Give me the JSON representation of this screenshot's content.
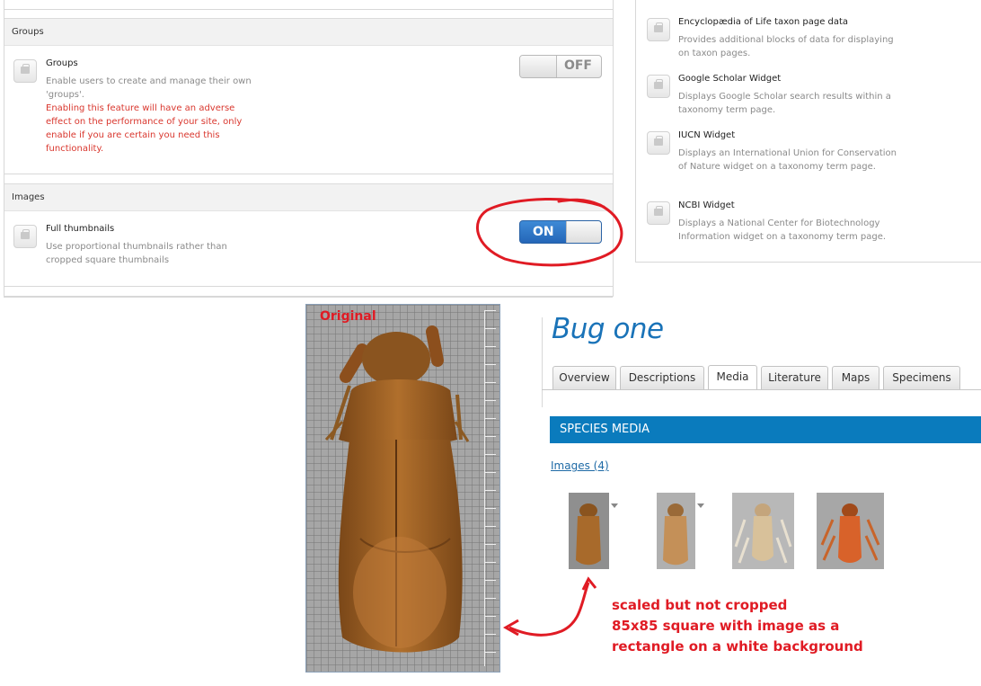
{
  "settings": {
    "groups_section": {
      "header": "Groups",
      "feature_title": "Groups",
      "description": "Enable users to create and manage their own 'groups'.",
      "warning": "Enabling this feature will have an adverse effect on the performance of your site, only enable if you are certain you need this functionality.",
      "toggle_label": "OFF",
      "toggle_state": "off"
    },
    "images_section": {
      "header": "Images",
      "feature_title": "Full thumbnails",
      "description": "Use proportional thumbnails rather than cropped square thumbnails",
      "toggle_label": "ON",
      "toggle_state": "on"
    }
  },
  "modules": [
    {
      "title": "Encyclopædia of Life taxon page data",
      "description": "Provides additional blocks of data for displaying on taxon pages."
    },
    {
      "title": "Google Scholar Widget",
      "description": "Displays Google Scholar search results within a taxonomy term page."
    },
    {
      "title": "IUCN Widget",
      "description": "Displays an International Union for Conservation of Nature widget on a taxonomy term page."
    },
    {
      "title": "NCBI Widget",
      "description": "Displays a National Center for Biotechnology Information widget on a taxonomy term page."
    }
  ],
  "taxon_page": {
    "title": "Bug one",
    "tabs": [
      "Overview",
      "Descriptions",
      "Media",
      "Literature",
      "Maps",
      "Specimens"
    ],
    "active_tab": "Media",
    "section_header": "SPECIES MEDIA",
    "images_link": "Images (4)"
  },
  "annotations": {
    "original_label": "Original",
    "note_line1": "scaled but not cropped",
    "note_line2": "85x85 square with image as a",
    "note_line3": "rectangle on a white background"
  },
  "colors": {
    "accent_blue": "#0a7bbd",
    "toggle_on": "#2d72c4",
    "annotation_red": "#e01b24",
    "warning_red": "#d9372e"
  }
}
